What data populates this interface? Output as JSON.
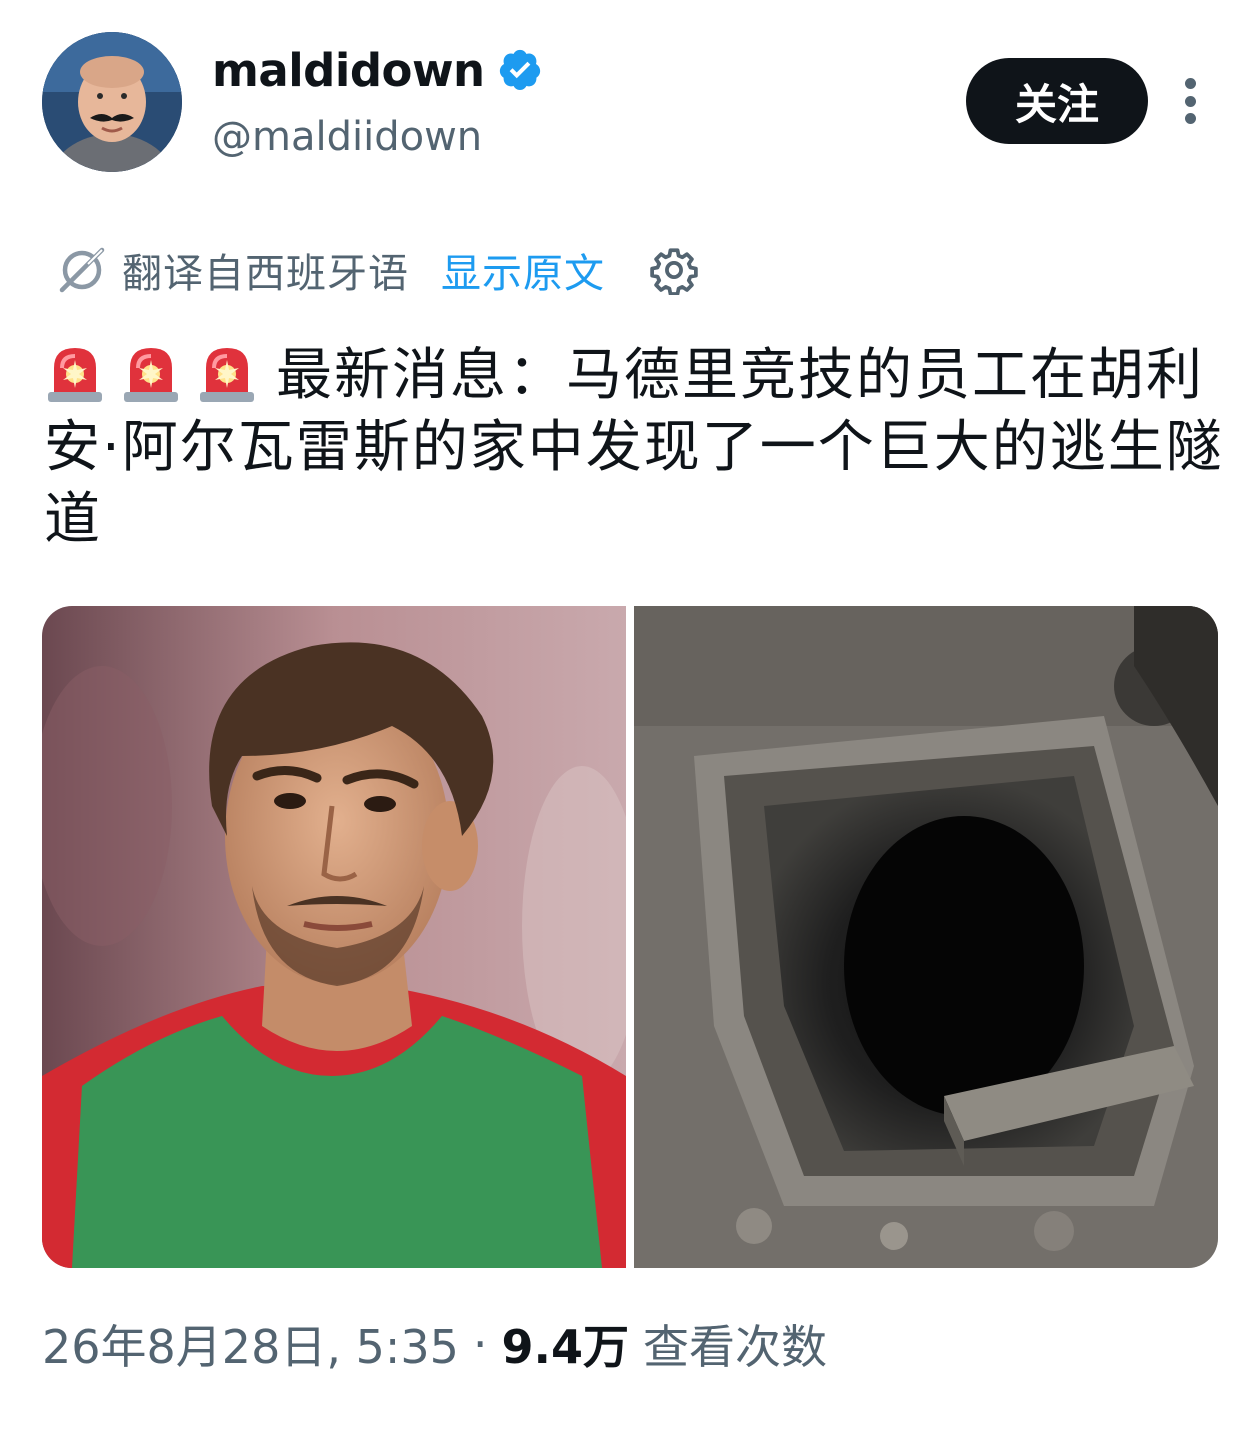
{
  "user": {
    "display_name": "maldidown",
    "handle": "@maldiidown",
    "verified": true
  },
  "header": {
    "follow_label": "关注"
  },
  "translation": {
    "label": "翻译自西班牙语",
    "show_original": "显示原文"
  },
  "tweet": {
    "emoji_prefix": "🚨🚨🚨",
    "text": "最新消息：马德里竞技的员工在胡利安·阿尔瓦雷斯的家中发现了一个巨大的逃生隧道"
  },
  "media": [
    {
      "name": "player-photo"
    },
    {
      "name": "tunnel-photo"
    }
  ],
  "meta": {
    "timestamp": "26年8月28日, 5:35",
    "separator": "·",
    "views_count": "9.4万",
    "views_label": "查看次数"
  },
  "colors": {
    "text_primary": "#0f1419",
    "text_secondary": "#536471",
    "link": "#1d9bf0",
    "verified": "#1d9bf0",
    "follow_button_bg": "#0f1419"
  }
}
